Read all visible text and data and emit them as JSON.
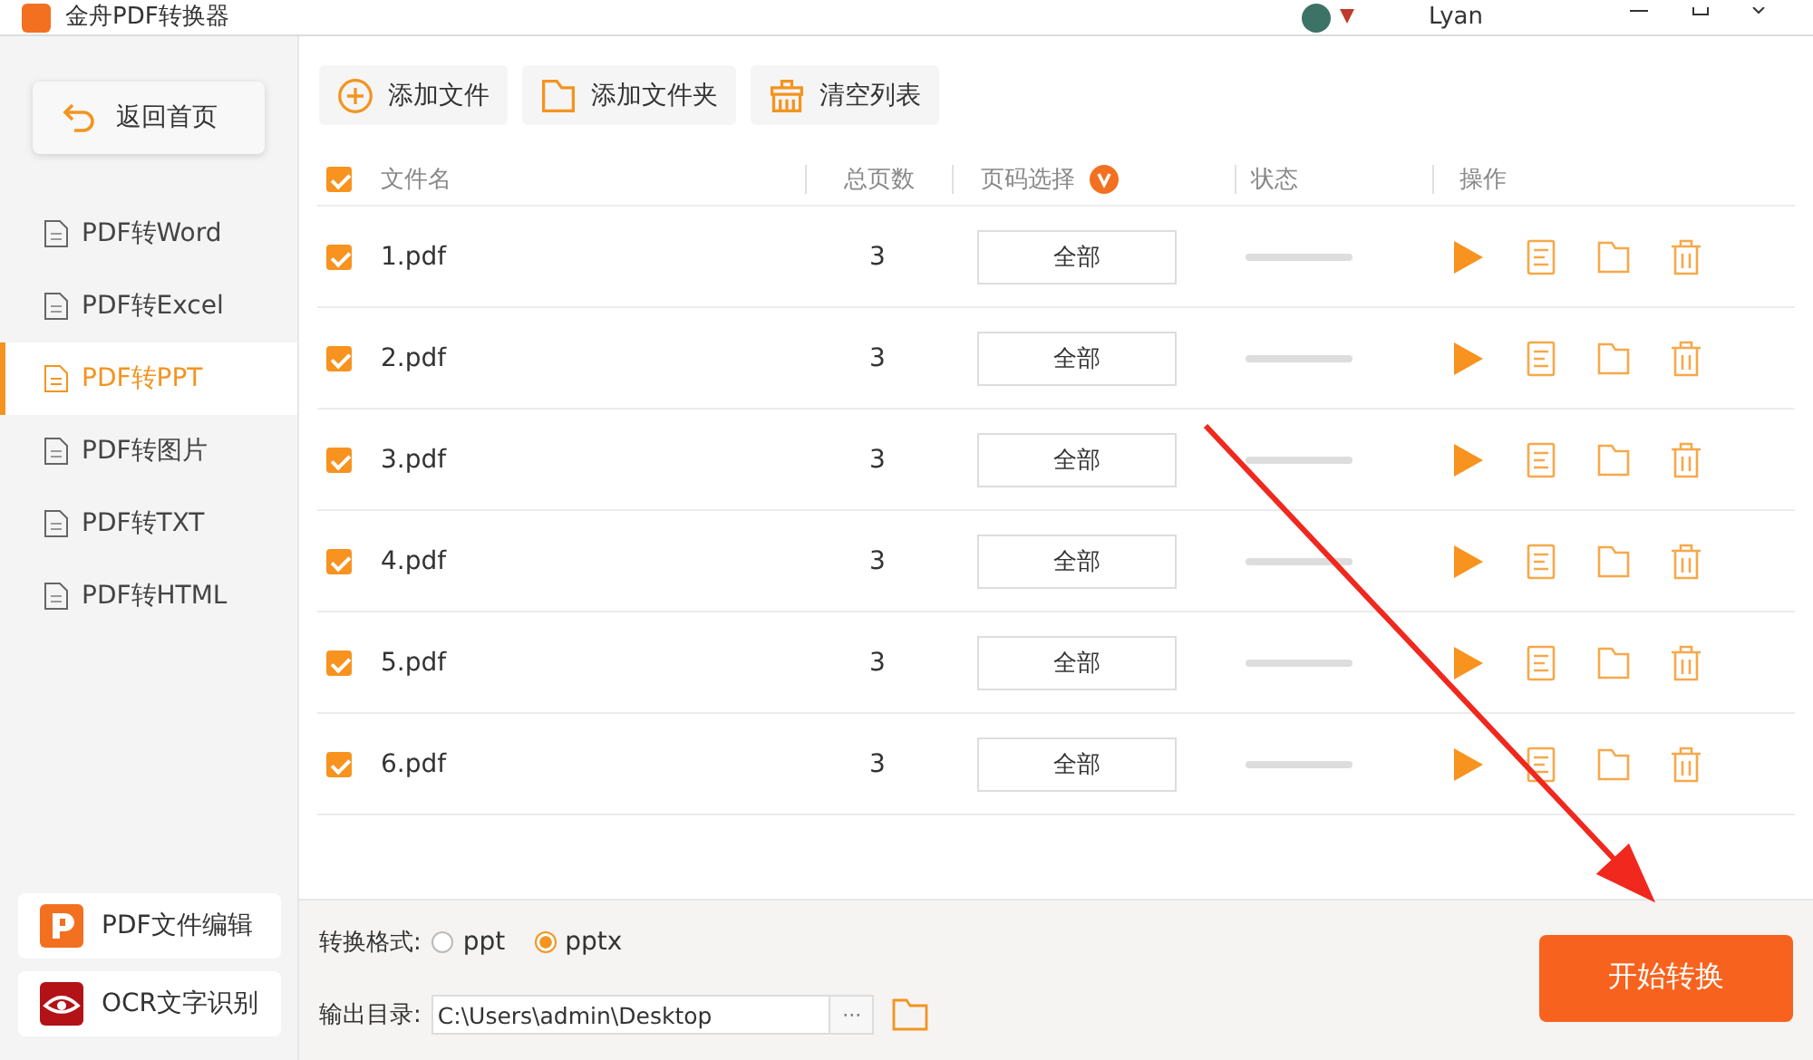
{
  "window": {
    "title": "金舟PDF转换器",
    "user": "Lyan"
  },
  "sidebar": {
    "back_button": "返回首页",
    "items": [
      {
        "label": "PDF转Word",
        "selected": false
      },
      {
        "label": "PDF转Excel",
        "selected": false
      },
      {
        "label": "PDF转PPT",
        "selected": true
      },
      {
        "label": "PDF转图片",
        "selected": false
      },
      {
        "label": "PDF转TXT",
        "selected": false
      },
      {
        "label": "PDF转HTML",
        "selected": false
      }
    ],
    "apps": [
      {
        "label": "PDF文件编辑",
        "kind": "editor"
      },
      {
        "label": "OCR文字识别",
        "kind": "ocr"
      }
    ]
  },
  "toolbar": [
    {
      "label": "添加文件",
      "kind": "add"
    },
    {
      "label": "添加文件夹",
      "kind": "folder"
    },
    {
      "label": "清空列表",
      "kind": "clear"
    }
  ],
  "table": {
    "all_checked": true,
    "columns": [
      "文件名",
      "总页数",
      "页码选择",
      "状态",
      "操作"
    ],
    "rows": [
      {
        "checked": true,
        "name": "1.pdf",
        "pages": "3",
        "range": "全部"
      },
      {
        "checked": true,
        "name": "2.pdf",
        "pages": "3",
        "range": "全部"
      },
      {
        "checked": true,
        "name": "3.pdf",
        "pages": "3",
        "range": "全部"
      },
      {
        "checked": true,
        "name": "4.pdf",
        "pages": "3",
        "range": "全部"
      },
      {
        "checked": true,
        "name": "5.pdf",
        "pages": "3",
        "range": "全部"
      },
      {
        "checked": true,
        "name": "6.pdf",
        "pages": "3",
        "range": "全部"
      }
    ]
  },
  "format": {
    "label": "转换格式:",
    "options": [
      {
        "label": "ppt",
        "selected": false
      },
      {
        "label": "pptx",
        "selected": true
      }
    ]
  },
  "output": {
    "label": "输出目录:",
    "value": "C:\\Users\\admin\\Desktop",
    "browse": "···"
  },
  "start_button": "开始转换"
}
